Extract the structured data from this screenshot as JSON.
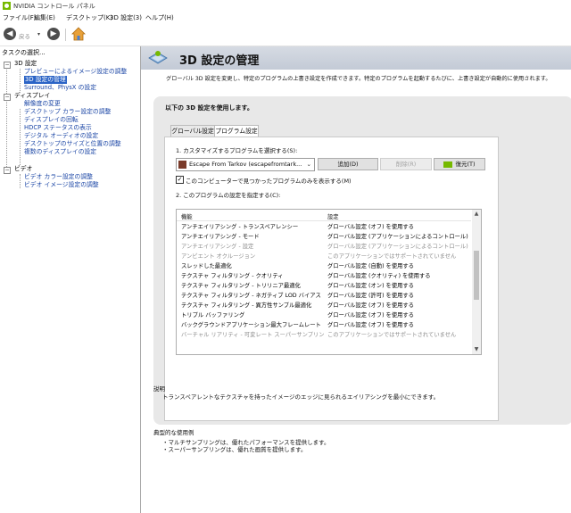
{
  "window": {
    "title": "NVIDIA コントロール パネル"
  },
  "menu": [
    "ファイル(F)",
    "編集(E)",
    "デスクトップ(K)",
    "3D 設定(3)",
    "ヘルプ(H)"
  ],
  "toolbar": {
    "back_label": "戻る"
  },
  "left": {
    "task_heading": "タスクの選択...",
    "tree": [
      {
        "label": "3D 設定",
        "type": "category"
      },
      {
        "label": "プレビューによるイメージ設定の調整",
        "type": "link"
      },
      {
        "label": "3D 設定の管理",
        "type": "selected"
      },
      {
        "label": "Surround、PhysX の設定",
        "type": "link"
      },
      {
        "label": "ディスプレイ",
        "type": "category"
      },
      {
        "label": "解像度の変更",
        "type": "link"
      },
      {
        "label": "デスクトップ カラー設定の調整",
        "type": "link"
      },
      {
        "label": "ディスプレイの回転",
        "type": "link"
      },
      {
        "label": "HDCP ステータスの表示",
        "type": "link"
      },
      {
        "label": "デジタル オーディオの設定",
        "type": "link"
      },
      {
        "label": "デスクトップのサイズと位置の調整",
        "type": "link"
      },
      {
        "label": "複数のディスプレイの設定",
        "type": "link"
      },
      {
        "label": "ビデオ",
        "type": "category"
      },
      {
        "label": "ビデオ カラー設定の調整",
        "type": "link"
      },
      {
        "label": "ビデオ イメージ設定の調整",
        "type": "link"
      }
    ]
  },
  "main": {
    "title": "3D 設定の管理",
    "description": "グローバル 3D 設定を変更し、特定のプログラムの上書き設定を作成できます。特定のプログラムを起動するたびに、上書き設定が自動的に使用されます。",
    "panel_heading": "以下の 3D 設定を使用します。",
    "tabs": [
      {
        "label": "グローバル設定"
      },
      {
        "label": "プログラム設定"
      }
    ],
    "step1_label": "1. カスタマイズするプログラムを選択する(S):",
    "program_selected": "Escape From Tarkov (escapefromtark...",
    "add_button": "追加(D)",
    "delete_button": "削除(R)",
    "restore_button": "復元(T)",
    "checkbox_label": "このコンピューターで見つかったプログラムのみを表示する(M)",
    "step2_label": "2. このプログラムの設定を指定する(C):",
    "table_headers": [
      "機能",
      "設定"
    ],
    "rows": [
      {
        "feature": "アンチエイリアシング - トランスペアレンシー",
        "setting": "グローバル設定 (オフ) を使用する",
        "dim": false
      },
      {
        "feature": "アンチエイリアシング - モード",
        "setting": "グローバル設定 (アプリケーションによるコントロール) を...",
        "dim": false
      },
      {
        "feature": "アンチエイリアシング - 設定",
        "setting": "グローバル設定 (アプリケーションによるコントロール) を...",
        "dim": true
      },
      {
        "feature": "アンビエント オクルージョン",
        "setting": "このアプリケーションではサポートされていません",
        "dim": true
      },
      {
        "feature": "スレッドした最適化",
        "setting": "グローバル設定 (自動) を使用する",
        "dim": false
      },
      {
        "feature": "テクスチャ フィルタリング - クオリティ",
        "setting": "グローバル設定 (クオリティ) を使用する",
        "dim": false
      },
      {
        "feature": "テクスチャ フィルタリング - トリリニア最適化",
        "setting": "グローバル設定 (オン) を使用する",
        "dim": false
      },
      {
        "feature": "テクスチャ フィルタリング - ネガティブ LOD バイアス",
        "setting": "グローバル設定 (許可) を使用する",
        "dim": false
      },
      {
        "feature": "テクスチャ フィルタリング - 異方性サンプル最適化",
        "setting": "グローバル設定 (オフ) を使用する",
        "dim": false
      },
      {
        "feature": "トリプル バッファリング",
        "setting": "グローバル設定 (オフ) を使用する",
        "dim": false
      },
      {
        "feature": "バックグラウンドアプリケーション最大フレームレート",
        "setting": "グローバル設定 (オフ) を使用する",
        "dim": false
      },
      {
        "feature": "バーチャル リアリティ - 可変レート スーパーサンプリング",
        "setting": "このアプリケーションではサポートされていません",
        "dim": true
      }
    ],
    "explanation_title": "説明",
    "explanation_text": "トランスペアレントなテクスチャを持ったイメージのエッジに見られるエイリアシングを最小にできます。",
    "usage_title": "典型的な使用例",
    "usage_items": [
      "・マルチサンプリングは、優れたパフォーマンスを提供します。",
      "・スーパーサンプリングは、優れた画質を提供します。"
    ]
  }
}
